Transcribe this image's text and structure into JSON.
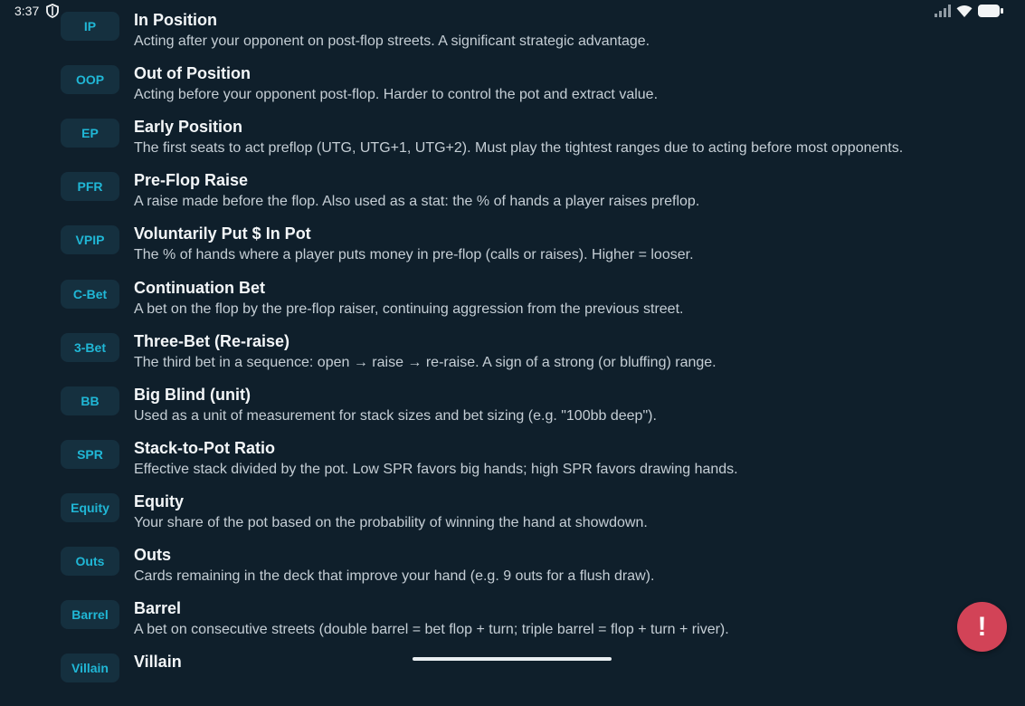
{
  "status_bar": {
    "time": "3:37",
    "shield_icon": "shield-icon",
    "signal_icon": "cellular-signal-icon",
    "wifi_icon": "wifi-icon",
    "battery_icon": "battery-icon"
  },
  "glossary": [
    {
      "abbr": "IP",
      "term": "In Position",
      "desc": "Acting after your opponent on post-flop streets. A significant strategic advantage."
    },
    {
      "abbr": "OOP",
      "term": "Out of Position",
      "desc": "Acting before your opponent post-flop. Harder to control the pot and extract value."
    },
    {
      "abbr": "EP",
      "term": "Early Position",
      "desc": "The first seats to act preflop (UTG, UTG+1, UTG+2). Must play the tightest ranges due to acting before most opponents."
    },
    {
      "abbr": "PFR",
      "term": "Pre-Flop Raise",
      "desc": "A raise made before the flop. Also used as a stat: the % of hands a player raises preflop."
    },
    {
      "abbr": "VPIP",
      "term": "Voluntarily Put $ In Pot",
      "desc": "The % of hands where a player puts money in pre-flop (calls or raises). Higher = looser."
    },
    {
      "abbr": "C-Bet",
      "term": "Continuation Bet",
      "desc": "A bet on the flop by the pre-flop raiser, continuing aggression from the previous street."
    },
    {
      "abbr": "3-Bet",
      "term": "Three-Bet (Re-raise)",
      "desc": "The third bet in a sequence: open → raise → re-raise. A sign of a strong (or bluffing) range."
    },
    {
      "abbr": "BB",
      "term": "Big Blind (unit)",
      "desc": "Used as a unit of measurement for stack sizes and bet sizing (e.g. \"100bb deep\")."
    },
    {
      "abbr": "SPR",
      "term": "Stack-to-Pot Ratio",
      "desc": "Effective stack divided by the pot. Low SPR favors big hands; high SPR favors drawing hands."
    },
    {
      "abbr": "Equity",
      "term": "Equity",
      "desc": "Your share of the pot based on the probability of winning the hand at showdown."
    },
    {
      "abbr": "Outs",
      "term": "Outs",
      "desc": "Cards remaining in the deck that improve your hand (e.g. 9 outs for a flush draw)."
    },
    {
      "abbr": "Barrel",
      "term": "Barrel",
      "desc": "A bet on consecutive streets (double barrel = bet flop + turn; triple barrel = flop + turn + river)."
    },
    {
      "abbr": "Villain",
      "term": "Villain",
      "desc": ""
    }
  ],
  "fab": {
    "label": "!",
    "color": "#d24357"
  },
  "colors": {
    "background": "#0f1f2b",
    "badge_bg": "#15303f",
    "accent": "#20b7d6"
  }
}
